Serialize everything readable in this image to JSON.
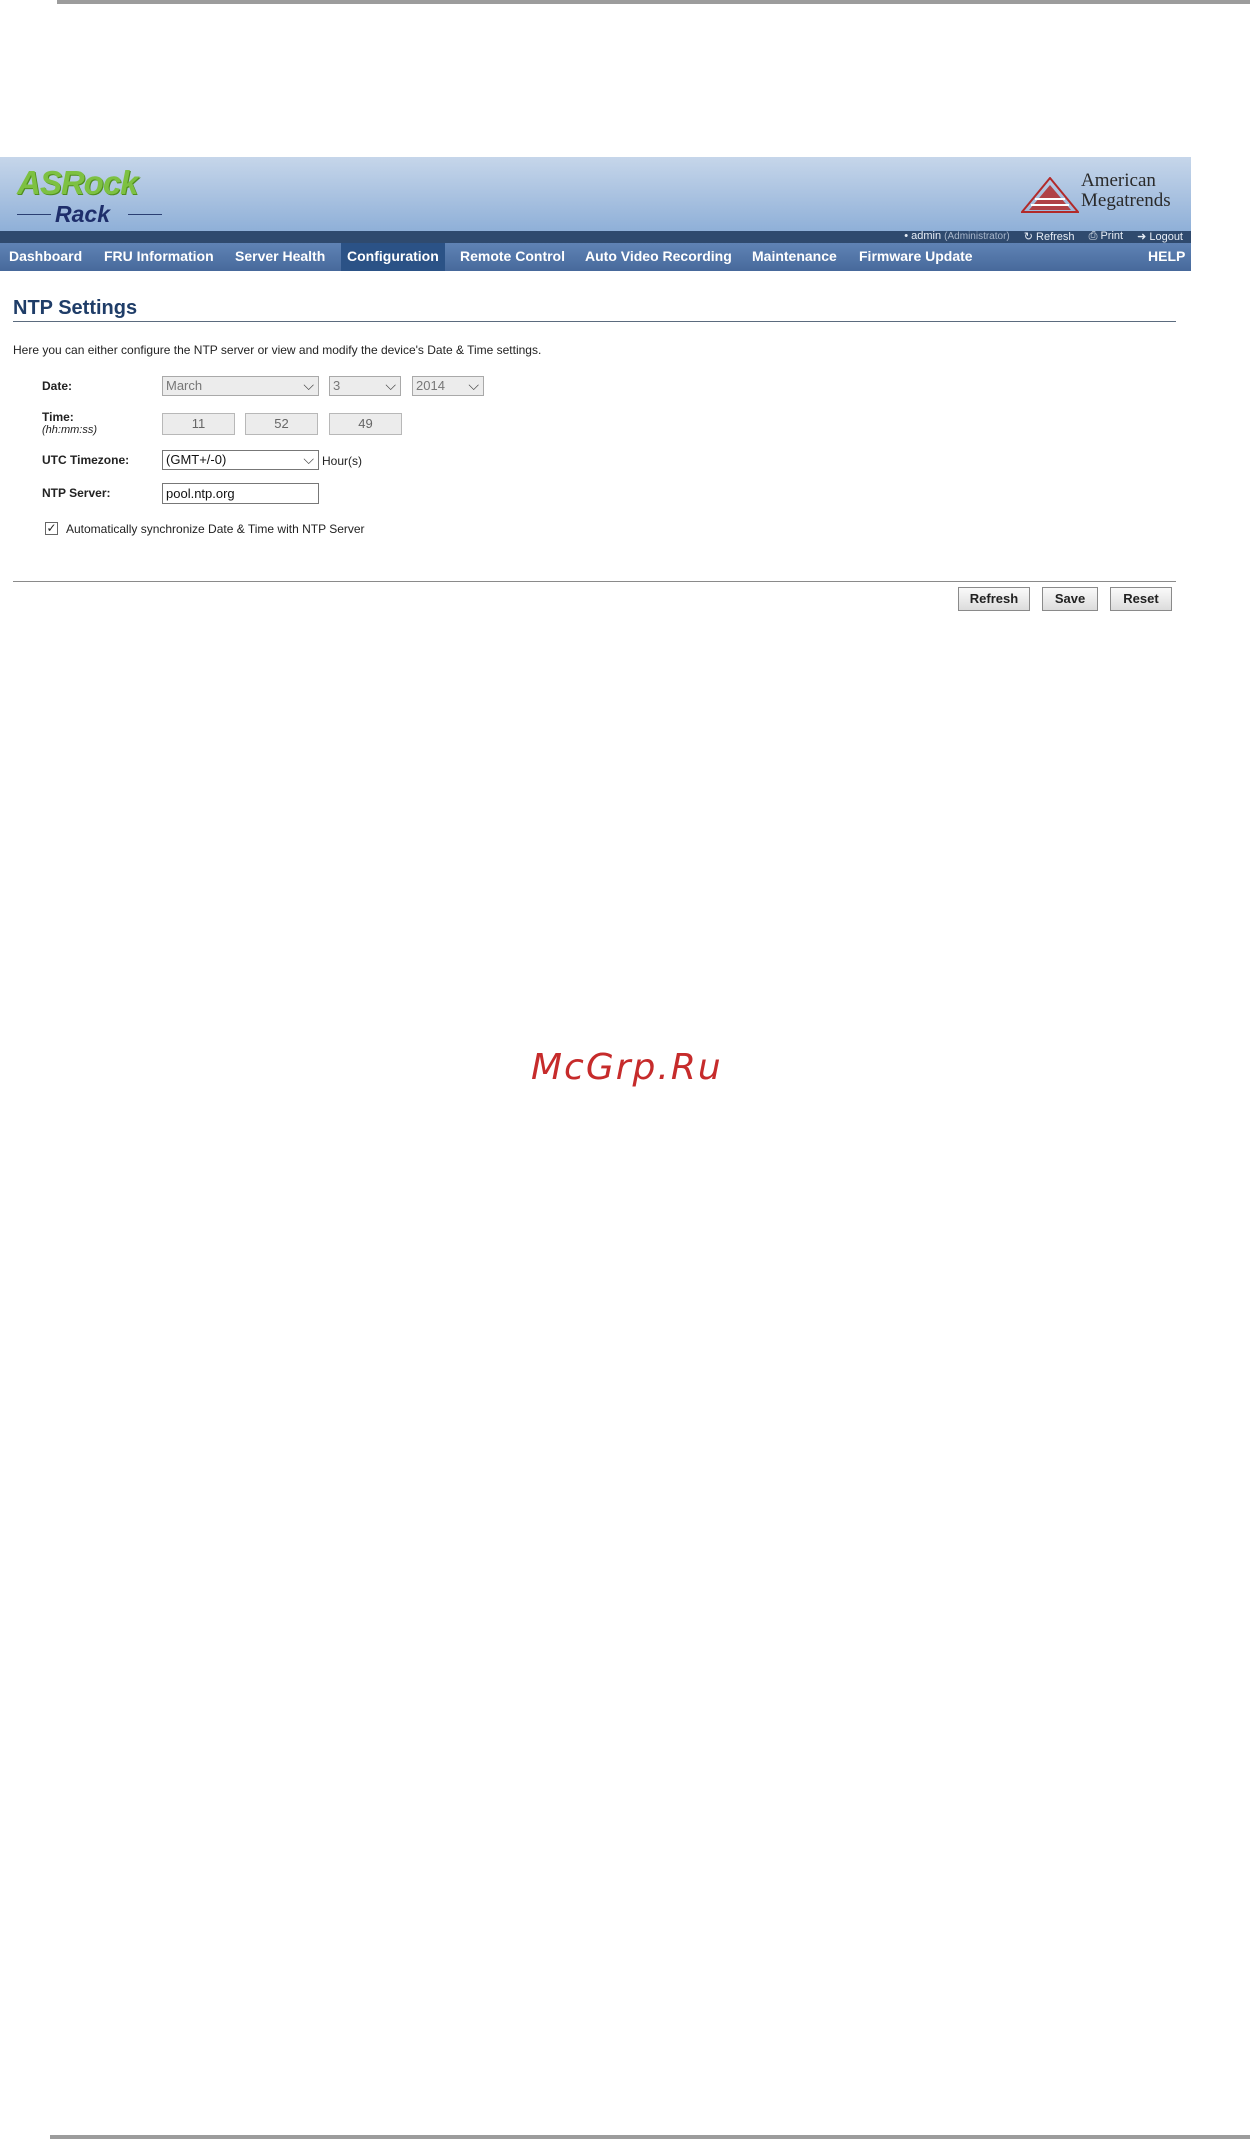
{
  "brand": {
    "asrock_top": "ASRock",
    "asrock_bottom": "Rack",
    "ami_line1": "American",
    "ami_line2": "Megatrends"
  },
  "userbar": {
    "user": "admin",
    "role": "(Administrator)",
    "refresh": "Refresh",
    "print": "Print",
    "logout": "Logout"
  },
  "nav": {
    "items": [
      {
        "label": "Dashboard"
      },
      {
        "label": "FRU Information"
      },
      {
        "label": "Server Health"
      },
      {
        "label": "Configuration"
      },
      {
        "label": "Remote Control"
      },
      {
        "label": "Auto Video Recording"
      },
      {
        "label": "Maintenance"
      },
      {
        "label": "Firmware Update"
      }
    ],
    "help": "HELP",
    "active": "Configuration"
  },
  "page": {
    "title": "NTP Settings",
    "description": "Here you can either configure the NTP server or view and modify the device's Date & Time settings."
  },
  "form": {
    "date_label": "Date:",
    "date_month": "March",
    "date_day": "3",
    "date_year": "2014",
    "time_label": "Time:",
    "time_format": "(hh:mm:ss)",
    "time_hh": "11",
    "time_mm": "52",
    "time_ss": "49",
    "utc_label": "UTC Timezone:",
    "utc_value": "(GMT+/-0)",
    "utc_unit": "Hour(s)",
    "ntp_label": "NTP Server:",
    "ntp_value": "pool.ntp.org",
    "auto_sync_label": "Automatically synchronize Date & Time with NTP Server",
    "auto_sync_checked": true
  },
  "buttons": {
    "refresh": "Refresh",
    "save": "Save",
    "reset": "Reset"
  },
  "watermark": "McGrp.Ru",
  "colors": {
    "asrock_green": "#7dc142",
    "nav_bg": "#47699b",
    "nav_active": "#2b5286",
    "title": "#1f3d68",
    "watermark": "#c62b2b"
  }
}
